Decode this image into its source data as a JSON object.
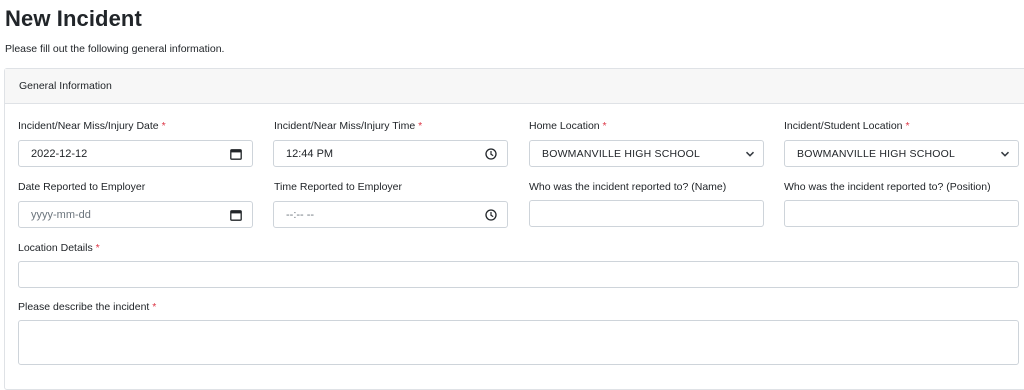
{
  "page": {
    "title": "New Incident",
    "subtitle": "Please fill out the following general information."
  },
  "card": {
    "header": "General Information"
  },
  "fields": {
    "incident_date": {
      "label": "Incident/Near Miss/Injury Date",
      "required": "*",
      "value": "2022-12-12",
      "icon": "calendar-icon"
    },
    "incident_time": {
      "label": "Incident/Near Miss/Injury Time",
      "required": "*",
      "value": "12:44 PM",
      "icon": "clock-icon"
    },
    "home_location": {
      "label": "Home Location",
      "required": "*",
      "value": "BOWMANVILLE HIGH SCHOOL",
      "icon": "chevron-down-icon"
    },
    "incident_location": {
      "label": "Incident/Student Location",
      "required": "*",
      "value": "BOWMANVILLE HIGH SCHOOL",
      "icon": "chevron-down-icon"
    },
    "date_reported": {
      "label": "Date Reported to Employer",
      "placeholder": "yyyy-mm-dd",
      "icon": "calendar-icon"
    },
    "time_reported": {
      "label": "Time Reported to Employer",
      "placeholder": "--:-- --",
      "icon": "clock-icon"
    },
    "reported_to_name": {
      "label": "Who was the incident reported to? (Name)",
      "value": ""
    },
    "reported_to_position": {
      "label": "Who was the incident reported to? (Position)",
      "value": ""
    },
    "location_details": {
      "label": "Location Details",
      "required": "*",
      "value": ""
    },
    "describe_incident": {
      "label": "Please describe the incident",
      "required": "*",
      "value": ""
    }
  },
  "colors": {
    "required": "#dc3545",
    "border": "#ced4da",
    "header_bg": "#f7f7f7"
  }
}
